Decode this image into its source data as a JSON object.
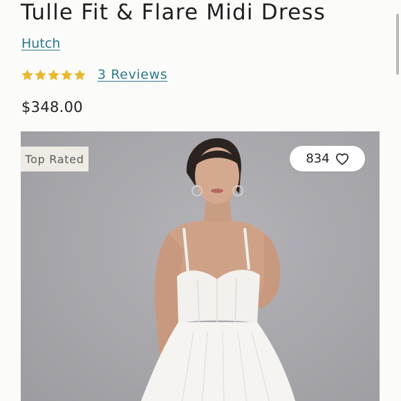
{
  "product": {
    "title": "Tulle Fit & Flare Midi Dress",
    "brand": "Hutch",
    "rating": 5,
    "max_rating": 5,
    "reviews_label": "3 Reviews",
    "price": "$348.00"
  },
  "image": {
    "badge": "Top Rated",
    "likes": "834",
    "alt_subject": "model wearing white tulle corset midi dress"
  },
  "colors": {
    "link": "#2c7a8e",
    "star": "#e9b82f",
    "badge_bg": "#eeeae4",
    "photo_bg": "#a9a8ad"
  },
  "icons": {
    "star": "star-icon",
    "like": "heart-outline-icon"
  }
}
